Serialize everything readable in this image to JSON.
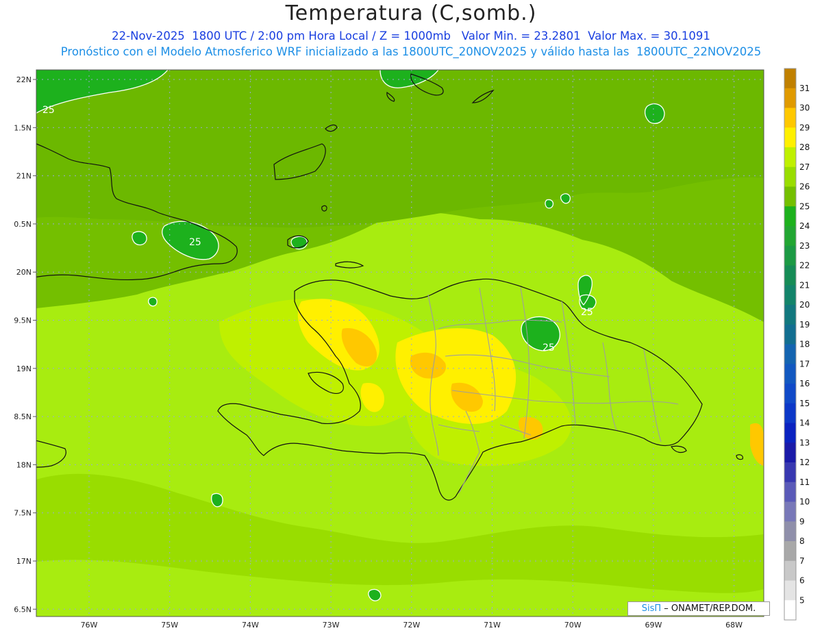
{
  "title": "Temperatura (C,somb.)",
  "subtitle_1": "22-Nov-2025  1800 UTC / 2:00 pm Hora Local / Z = 1000mb   Valor Min. = 23.2801  Valor Max. = 30.1091",
  "subtitle_2": "Pronóstico con el Modelo Atmosferico WRF inicializado a las 1800UTC_20NOV2025 y válido hasta las  1800UTC_22NOV2025",
  "credit": {
    "logo": "SisΠ",
    "text": " – ONAMET/REP.DOM."
  },
  "map": {
    "region": "Hispaniola / Caribbean",
    "lat_ticks": [
      "22N",
      "21.5N",
      "21N",
      "20.5N",
      "20N",
      "19.5N",
      "19N",
      "18.5N",
      "18N",
      "17.5N",
      "17N",
      "16.5N"
    ],
    "lat_tick_labels": [
      "22N",
      "1.5N",
      "21N",
      "0.5N",
      "20N",
      "9.5N",
      "19N",
      "8.5N",
      "18N",
      "7.5N",
      "17N",
      "6.5N"
    ],
    "lon_tick_labels": [
      "76W",
      "75W",
      "74W",
      "73W",
      "72W",
      "71W",
      "70W",
      "69W",
      "68W"
    ],
    "contour_labels": [
      "25",
      "25",
      "25",
      "25"
    ],
    "value_range_c": [
      23.2801,
      30.1091
    ]
  },
  "colorbar": {
    "labels": [
      "31",
      "30",
      "29",
      "28",
      "27",
      "26",
      "25",
      "24",
      "23",
      "22",
      "21",
      "20",
      "19",
      "18",
      "17",
      "16",
      "15",
      "14",
      "13",
      "12",
      "11",
      "10",
      "9",
      "8",
      "7",
      "6",
      "5"
    ],
    "colors": [
      "#c08000",
      "#e09a00",
      "#ffc800",
      "#fff000",
      "#bff000",
      "#99dd00",
      "#74bf00",
      "#1db11d",
      "#22a632",
      "#1c9a44",
      "#168c56",
      "#13846a",
      "#12787e",
      "#126e90",
      "#1464b0",
      "#1258c0",
      "#104ac8",
      "#0c38c8",
      "#0a22c0",
      "#1a1aa8",
      "#3838b0",
      "#5a5ab8",
      "#7878b8",
      "#8f8faa",
      "#a8a8a8",
      "#c8c8c8",
      "#e4e4e4",
      "#ffffff"
    ]
  }
}
